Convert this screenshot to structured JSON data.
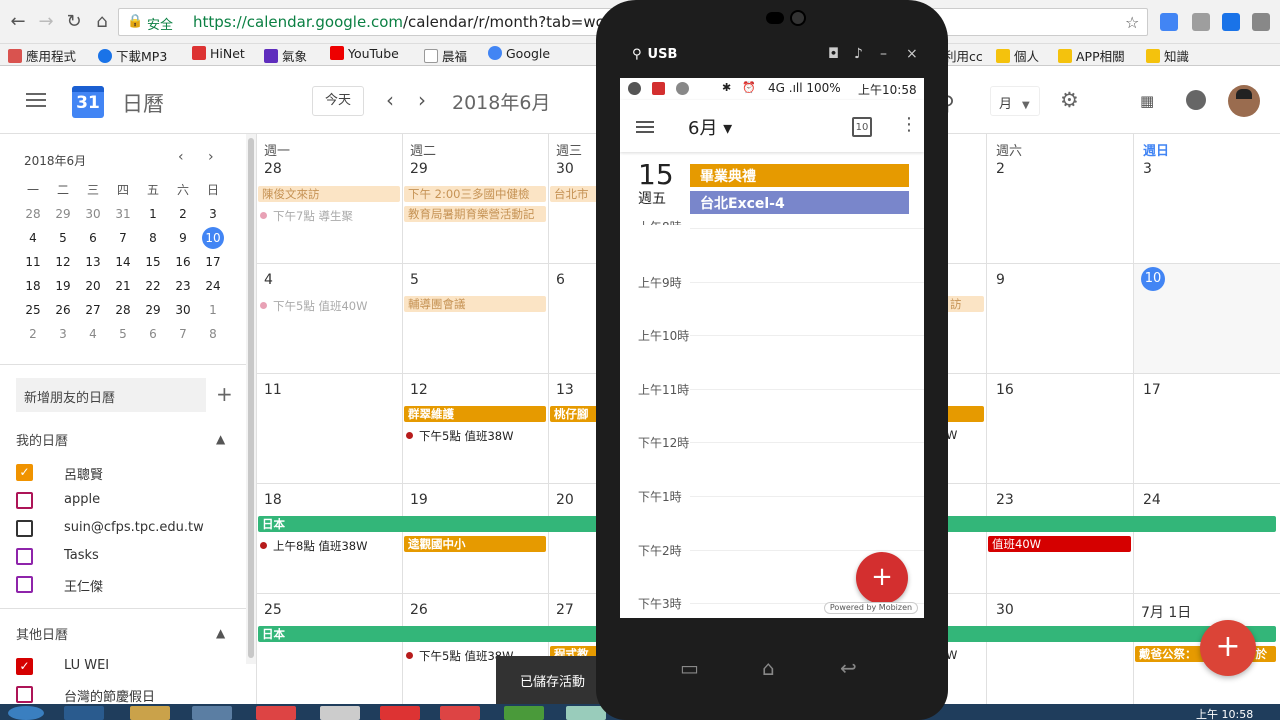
{
  "browser": {
    "secure_label": "安全",
    "url_host": "https://calendar.google.com",
    "url_path": "/calendar/r/month?tab=wc"
  },
  "bookmarks": [
    {
      "label": "應用程式",
      "color": "#e33"
    },
    {
      "label": "下載MP3",
      "color": "#1a73e8"
    },
    {
      "label": "HiNet",
      "color": "#d33"
    },
    {
      "label": "氣象",
      "color": "#5f2dbd"
    },
    {
      "label": "YouTube",
      "color": "#e00"
    },
    {
      "label": "晨福",
      "color": "#888"
    },
    {
      "label": "Google",
      "color": "#4285f4"
    },
    {
      "label": "利用cc",
      "color": "#f4c20d"
    },
    {
      "label": "個人",
      "color": "#f4c20d"
    },
    {
      "label": "APP相關",
      "color": "#f4c20d"
    },
    {
      "label": "知識",
      "color": "#f4c20d"
    }
  ],
  "header": {
    "logo_day": "31",
    "app_title": "日曆",
    "today_button": "今天",
    "month_title": "2018年6月",
    "view_select": "月"
  },
  "mini_calendar": {
    "title": "2018年6月",
    "weekdays": [
      "一",
      "二",
      "三",
      "四",
      "五",
      "六",
      "日"
    ],
    "weeks": [
      [
        "28",
        "29",
        "30",
        "31",
        "1",
        "2",
        "3"
      ],
      [
        "4",
        "5",
        "6",
        "7",
        "8",
        "9",
        "10"
      ],
      [
        "11",
        "12",
        "13",
        "14",
        "15",
        "16",
        "17"
      ],
      [
        "18",
        "19",
        "20",
        "21",
        "22",
        "23",
        "24"
      ],
      [
        "25",
        "26",
        "27",
        "28",
        "29",
        "30",
        "1"
      ],
      [
        "2",
        "3",
        "4",
        "5",
        "6",
        "7",
        "8"
      ]
    ],
    "selected": "10"
  },
  "sidebar": {
    "add_friend": "新增朋友的日曆",
    "my_calendars_title": "我的日曆",
    "my_calendars": [
      {
        "label": "呂聰賢",
        "color": "#f09300",
        "checked": true
      },
      {
        "label": "apple",
        "color": "#ad1457",
        "checked": false
      },
      {
        "label": "suin@cfps.tpc.edu.tw",
        "color": "#333333",
        "checked": false
      },
      {
        "label": "Tasks",
        "color": "#8e24aa",
        "checked": false
      },
      {
        "label": "王仁傑",
        "color": "#8e24aa",
        "checked": false
      }
    ],
    "other_calendars_title": "其他日曆",
    "other_calendars": [
      {
        "label": "LU WEI",
        "color": "#d50000",
        "checked": true
      },
      {
        "label": "台灣的節慶假日",
        "color": "#ad1457",
        "checked": false
      }
    ]
  },
  "month": {
    "day_names": [
      "週一",
      "週二",
      "週三",
      "",
      "",
      "週六",
      "週日"
    ],
    "row1": [
      "28",
      "29",
      "30",
      "",
      "",
      "2",
      "3"
    ],
    "row2": [
      "4",
      "5",
      "6",
      "",
      "",
      "9",
      "10"
    ],
    "row3": [
      "11",
      "12",
      "13",
      "",
      "",
      "16",
      "17"
    ],
    "row4": [
      "18",
      "19",
      "20",
      "",
      "",
      "23",
      "24"
    ],
    "row5": [
      "25",
      "26",
      "27",
      "",
      "",
      "30",
      "7月 1日"
    ],
    "events": {
      "e1": "陳俊文來訪",
      "e2": "下午 2:00三多國中健檢",
      "e3": "台北市",
      "e4": "下午7點 導生聚",
      "e5": "教育局暑期育樂營活動記",
      "e6": "下午5點 值班40W",
      "e7": "輔導團會議",
      "e8": "訪",
      "e9": "群翠維護",
      "e10": "桃仔腳",
      "e11": "下午5點 值班38W",
      "e12": "W",
      "e13": "日本",
      "e14": "上午8點 值班38W",
      "e15": "逵觀國中小",
      "e16": "值班40W",
      "e17": "日本",
      "e18": "下午5點 值班38W",
      "e19": "W",
      "e20": "程式教",
      "e21": "戴爸公祭：",
      "e22": "于於"
    }
  },
  "snackbar": "已儲存活動",
  "clock": "上午 10:58",
  "phone": {
    "usb_label": "USB",
    "status_text": "4G .ıll 100%",
    "status_clock": "上午10:58",
    "month_label": "6月 ▾",
    "cal_icon_day": "10",
    "date_big": "15",
    "date_week": "週五",
    "events": [
      "畢業典禮",
      "台北Excel-4"
    ],
    "hours": [
      "上午8時",
      "上午9時",
      "上午10時",
      "上午11時",
      "下午12時",
      "下午1時",
      "下午2時",
      "下午3時"
    ],
    "powered_by": "Powered by Mobizen"
  }
}
